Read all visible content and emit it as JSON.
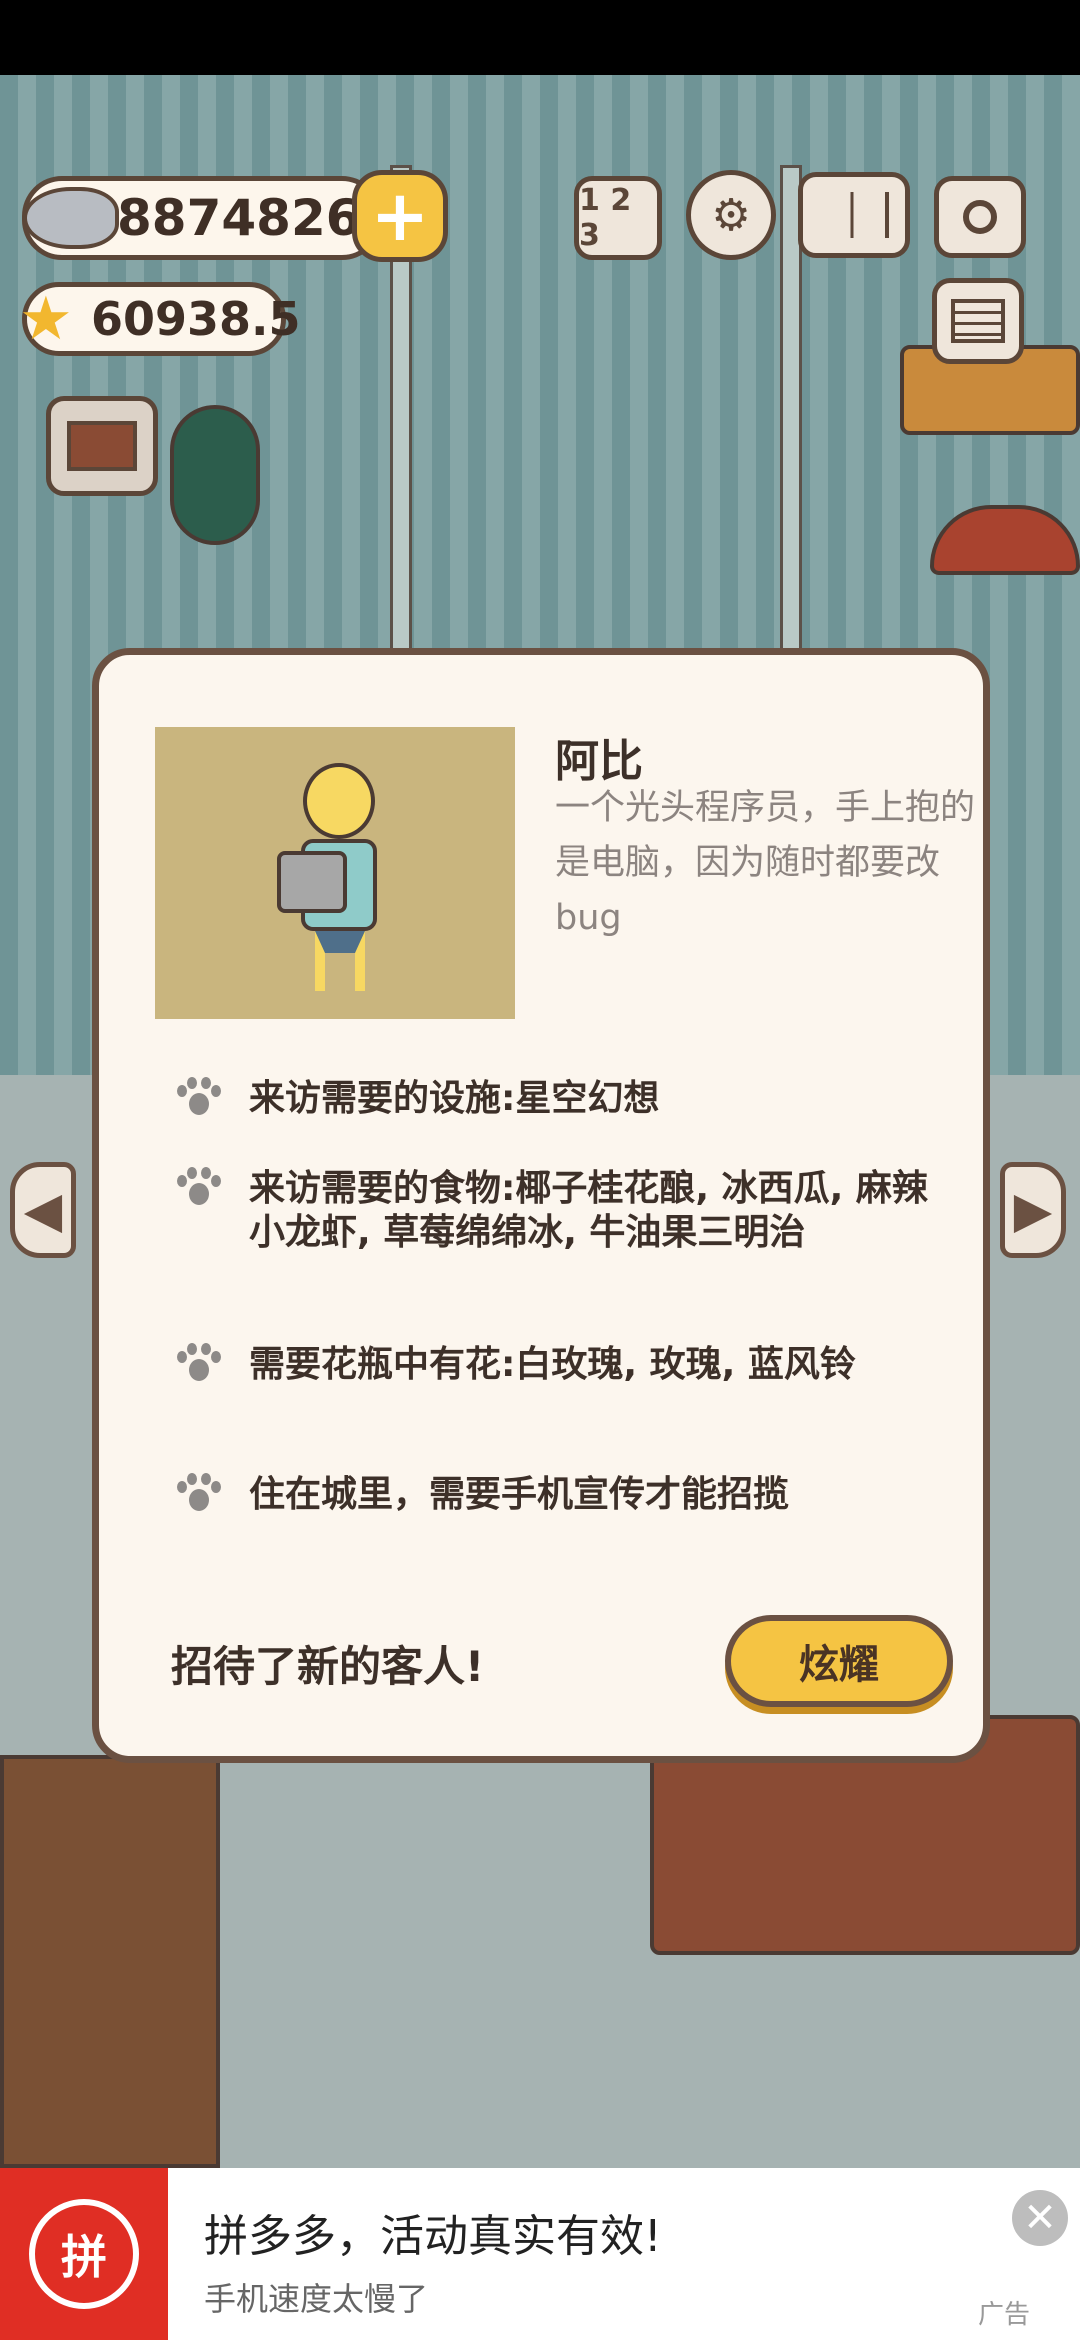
{
  "hud": {
    "fish_count": "8874826",
    "star_count": "60938.5",
    "add_label": "+",
    "rank_label": "1 2 3"
  },
  "guest_card": {
    "name": "阿比",
    "description": "一个光头程序员，手上抱的是电脑，因为随时都要改bug",
    "requirements": [
      "来访需要的设施:星空幻想",
      "来访需要的食物:椰子桂花酿, 冰西瓜, 麻辣小龙虾, 草莓绵绵冰, 牛油果三明治",
      "需要花瓶中有花:白玫瑰, 玫瑰, 蓝风铃",
      "住在城里，需要手机宣传才能招揽"
    ],
    "welcome_text": "招待了新的客人!",
    "show_off_label": "炫耀"
  },
  "nav": {
    "prev_glyph": "◀",
    "next_glyph": "▶"
  },
  "ad": {
    "logo_text": "拼",
    "title": "拼多多，活动真实有效!",
    "subtitle": "手机速度太慢了",
    "close_glyph": "✕",
    "tag": "广告"
  },
  "colors": {
    "accent_button": "#f5c443",
    "dialog_bg": "#fcf6ee",
    "border": "#6b5142",
    "portrait_bg": "#c9b57e",
    "ad_brand": "#e02e24"
  },
  "icons": [
    "fish-icon",
    "star-icon",
    "plus-icon",
    "rank-icon",
    "gear-icon",
    "book-icon",
    "camera-icon",
    "newspaper-icon",
    "shop-icon",
    "paw-icon",
    "close-icon"
  ]
}
